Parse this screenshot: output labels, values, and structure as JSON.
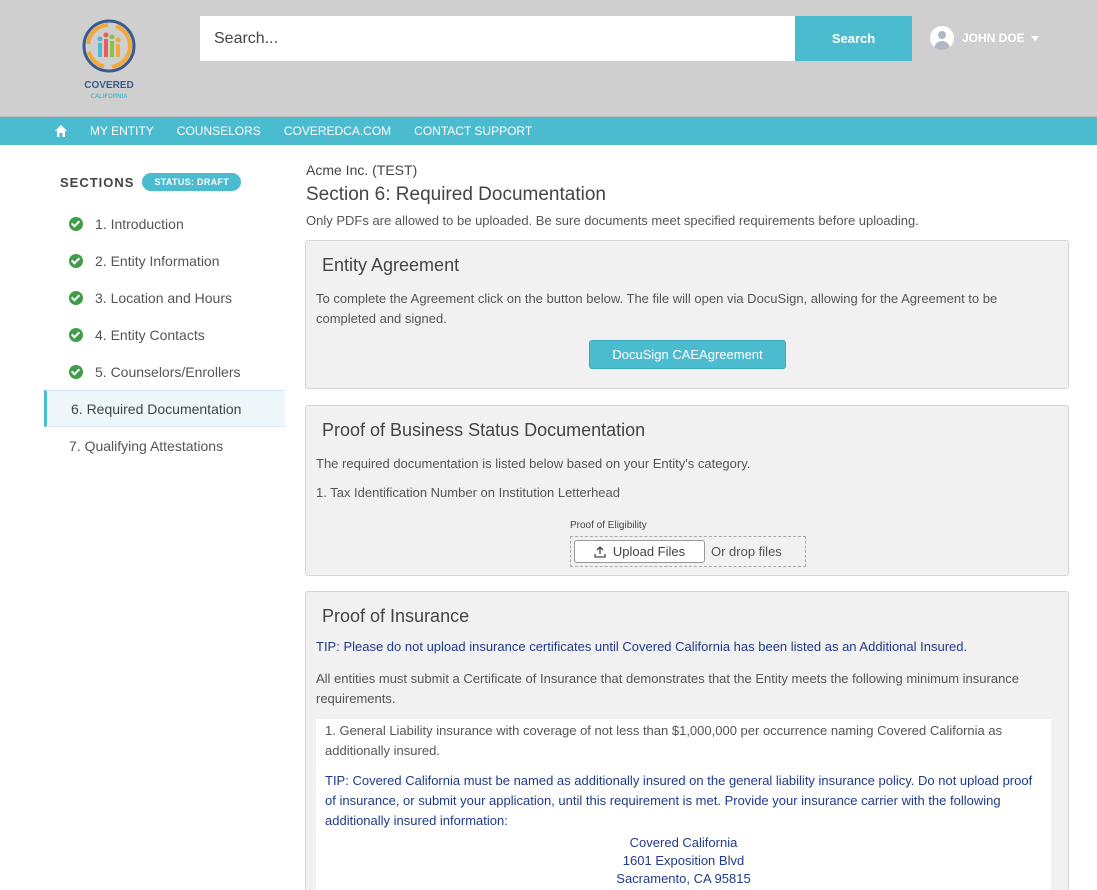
{
  "brand": {
    "name": "COVERED",
    "sub": "CALIFORNIA"
  },
  "search": {
    "placeholder": "Search...",
    "button_label": "Search"
  },
  "user": {
    "name": "JOHN DOE"
  },
  "nav": {
    "items": [
      "MY ENTITY",
      "COUNSELORS",
      "COVEREDCA.COM",
      "CONTACT SUPPORT"
    ]
  },
  "sidebar": {
    "title": "SECTIONS",
    "status": "STATUS: DRAFT",
    "items": [
      {
        "label": "1. Introduction",
        "complete": true
      },
      {
        "label": "2. Entity Information",
        "complete": true
      },
      {
        "label": "3. Location and Hours",
        "complete": true
      },
      {
        "label": "4. Entity Contacts",
        "complete": true
      },
      {
        "label": "5. Counselors/Enrollers",
        "complete": true
      },
      {
        "label": "6. Required Documentation",
        "complete": false,
        "active": true
      },
      {
        "label": "7. Qualifying Attestations",
        "complete": false
      }
    ]
  },
  "main": {
    "entity": "Acme Inc. (TEST)",
    "title": "Section 6: Required Documentation",
    "description": "Only PDFs are allowed to be uploaded. Be sure documents meet specified requirements before uploading.",
    "agreement": {
      "title": "Entity Agreement",
      "text": "To complete the Agreement click on the button below. The file will open via DocuSign, allowing for the Agreement to be completed and signed.",
      "button": "DocuSign CAEAgreement"
    },
    "business": {
      "title": "Proof of Business Status Documentation",
      "text": "The required documentation is listed below based on your Entity's category.",
      "item": "1. Tax Identification Number on Institution Letterhead",
      "upload_label": "Proof of Eligibility",
      "upload_button": "Upload Files",
      "drop_text": "Or drop files"
    },
    "insurance": {
      "title": "Proof of Insurance",
      "tip": "TIP: Please do not upload insurance certificates until Covered California has been listed as an Additional Insured.",
      "text": "All entities must submit a Certificate of Insurance that demonstrates that the Entity meets the following minimum insurance requirements.",
      "item1": "1. General Liability insurance with coverage of not less than $1,000,000 per occurrence naming Covered California as additionally insured.",
      "tip2": "TIP: Covered California must be named as additionally insured on the general liability insurance policy. Do not upload proof of insurance, or submit your application, until this requirement is met. Provide your insurance carrier with the following additionally insured information:",
      "address": [
        "Covered California",
        "1601 Exposition Blvd",
        "Sacramento, CA 95815"
      ]
    }
  },
  "colors": {
    "accent": "#4bbbd0",
    "check": "#3f9d49",
    "tip": "#1f3a8a",
    "header_bg": "#cfcfcf"
  }
}
